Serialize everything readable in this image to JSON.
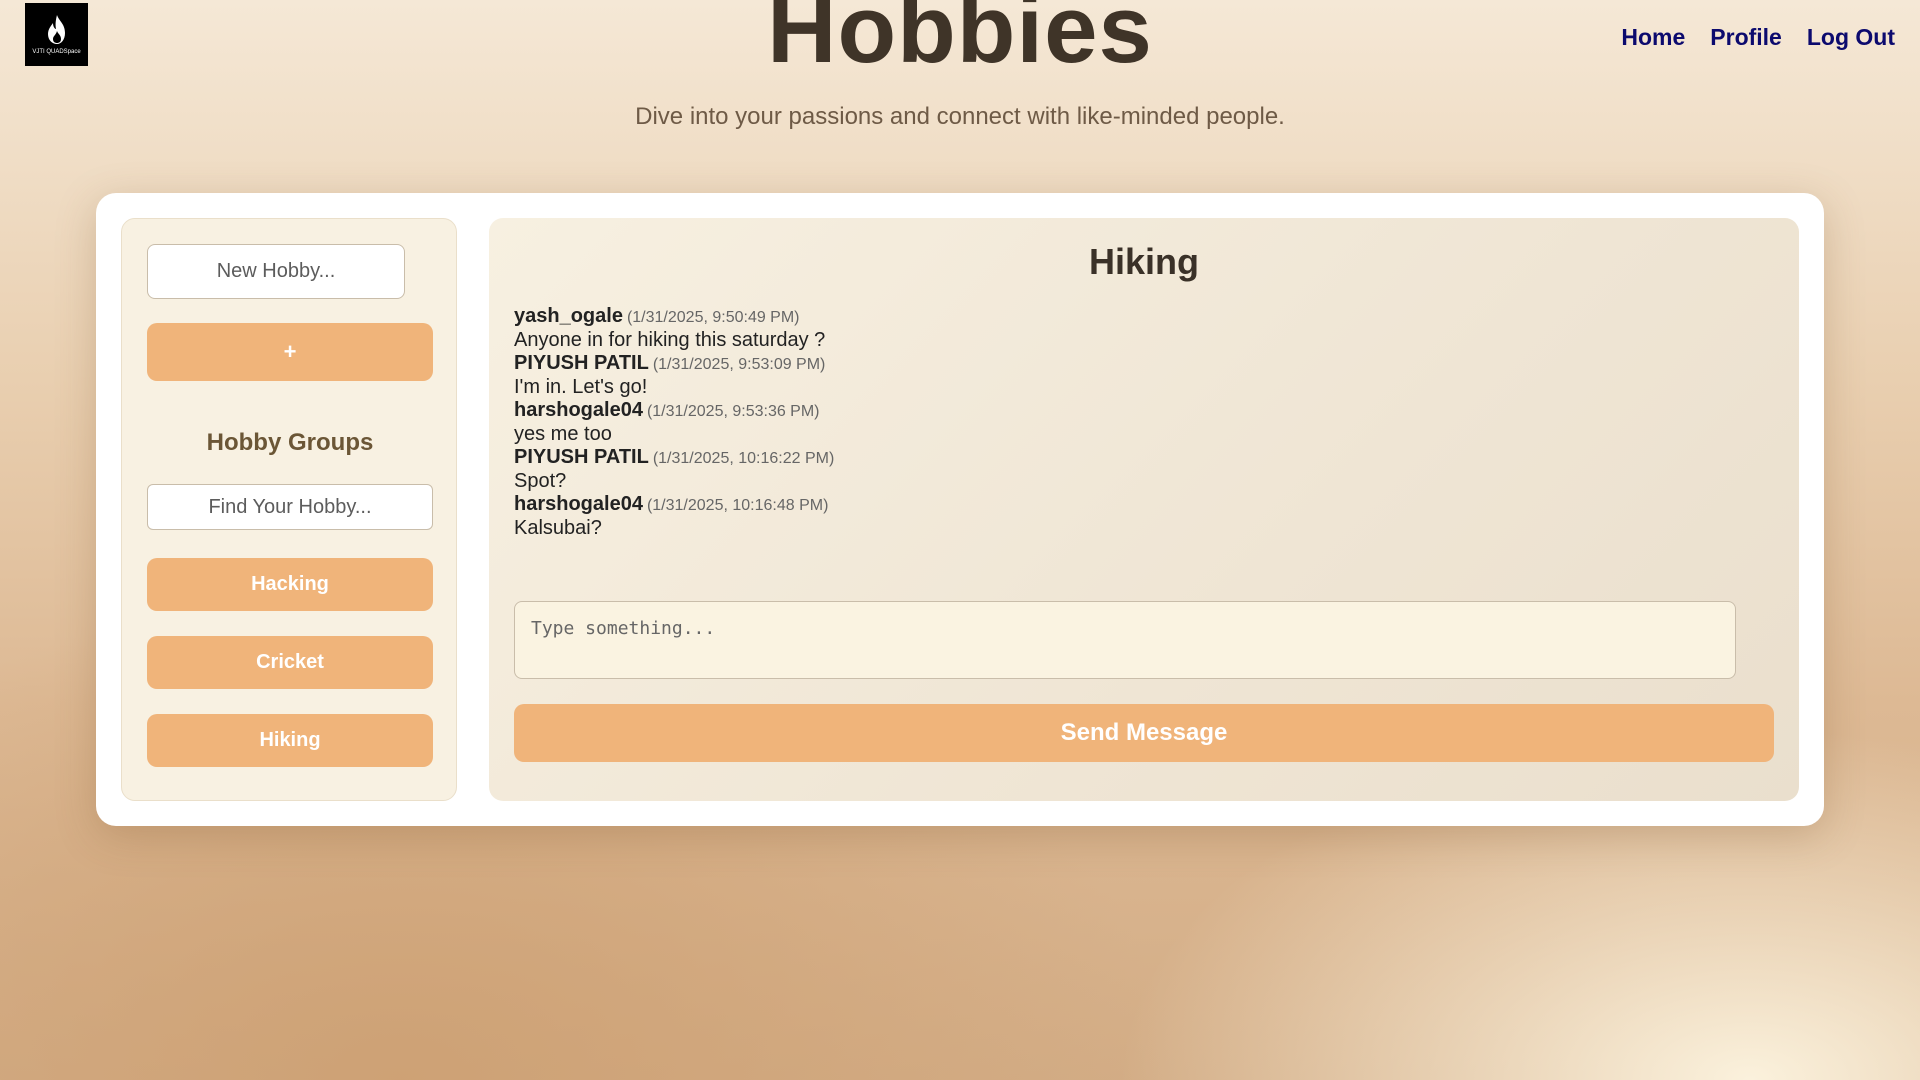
{
  "logo": {
    "text": "VJTI QUADSpace",
    "icon": "flame-icon"
  },
  "header": {
    "title": "Hobbies",
    "subtitle": "Dive into your passions and connect with like-minded people."
  },
  "nav": {
    "home": "Home",
    "profile": "Profile",
    "logout": "Log Out"
  },
  "sidebar": {
    "new_hobby_placeholder": "New Hobby...",
    "add_label": "+",
    "groups_title": "Hobby Groups",
    "find_placeholder": "Find Your Hobby...",
    "groups": [
      "Hacking",
      "Cricket",
      "Hiking"
    ]
  },
  "chat": {
    "title": "Hiking",
    "messages": [
      {
        "user": "yash_ogale",
        "time": "(1/31/2025, 9:50:49 PM)",
        "text": "Anyone in for hiking this saturday ?"
      },
      {
        "user": "PIYUSH PATIL",
        "time": "(1/31/2025, 9:53:09 PM)",
        "text": "I'm in. Let's go!"
      },
      {
        "user": "harshogale04",
        "time": "(1/31/2025, 9:53:36 PM)",
        "text": "yes me too"
      },
      {
        "user": "PIYUSH PATIL",
        "time": "(1/31/2025, 10:16:22 PM)",
        "text": "Spot?"
      },
      {
        "user": "harshogale04",
        "time": "(1/31/2025, 10:16:48 PM)",
        "text": "Kalsubai?"
      }
    ],
    "input_placeholder": "Type something...",
    "send_label": "Send Message"
  },
  "colors": {
    "accent": "#f0b47a",
    "nav_link": "#0c0a6e",
    "title": "#3f3428"
  }
}
